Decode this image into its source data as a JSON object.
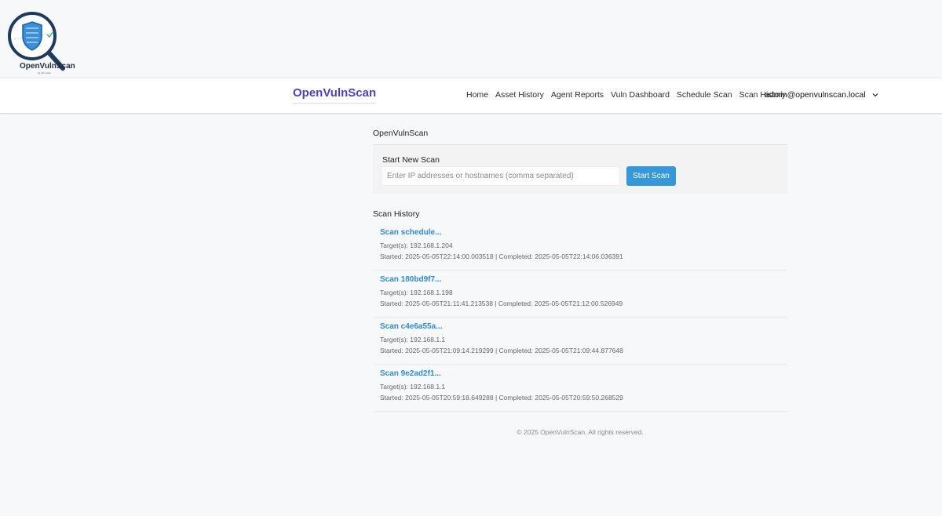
{
  "logo": {
    "text": "OpenVulnScan",
    "subtext": "by vuln scan"
  },
  "navbar": {
    "brand": "OpenVulnScan",
    "links": [
      "Home",
      "Asset History",
      "Agent Reports",
      "Vuln Dashboard",
      "Schedule Scan",
      "Scan History"
    ],
    "user": "admin@openvulnscan.local"
  },
  "main": {
    "title": "OpenVulnScan",
    "new_scan": {
      "title": "Start New Scan",
      "input_placeholder": "Enter IP addresses or hostnames (comma separated)",
      "input_value": "",
      "button_label": "Start Scan"
    },
    "history": {
      "title": "Scan History",
      "items": [
        {
          "name": "Scan schedule...",
          "targets": "Target(s): 192.168.1.204",
          "times": "Started: 2025-05-05T22:14:00.003518 | Completed: 2025-05-05T22:14:06.036391"
        },
        {
          "name": "Scan 180bd9f7...",
          "targets": "Target(s): 192.168.1.198",
          "times": "Started: 2025-05-05T21:11:41.213538 | Completed: 2025-05-05T21:12:00.526949"
        },
        {
          "name": "Scan c4e6a55a...",
          "targets": "Target(s): 192.168.1.1",
          "times": "Started: 2025-05-05T21:09:14.219299 | Completed: 2025-05-05T21:09:44.877648"
        },
        {
          "name": "Scan 9e2ad2f1...",
          "targets": "Target(s): 192.168.1.1",
          "times": "Started: 2025-05-05T20:59:18.649288 | Completed: 2025-05-05T20:59:50.268529"
        }
      ]
    }
  },
  "footer": "© 2025 OpenVulnScan. All rights reserved.",
  "colors": {
    "brand": "#4a3fc8",
    "accent": "#3498db",
    "link": "#2f8ad6"
  }
}
